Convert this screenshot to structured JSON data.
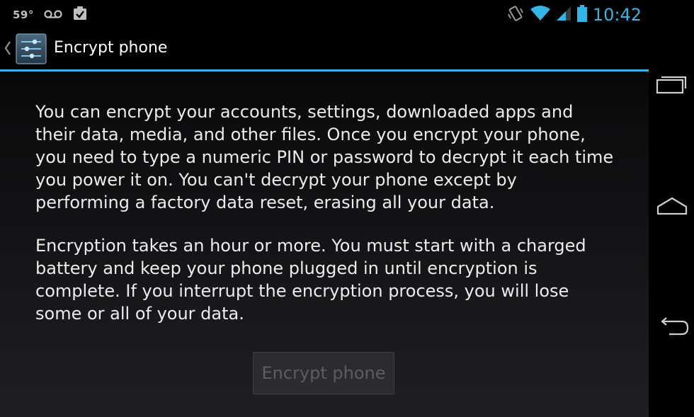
{
  "status_bar": {
    "temperature": "59°",
    "time": "10:42",
    "icons": [
      "voicemail-icon",
      "clipboard-check-icon",
      "vibrate-icon",
      "wifi-icon",
      "signal-icon",
      "battery-icon"
    ]
  },
  "action_bar": {
    "title": "Encrypt phone",
    "icon": "settings-sliders-icon"
  },
  "main": {
    "paragraphs": [
      "You can encrypt your accounts, settings, downloaded apps and their data, media, and other files. Once you encrypt your phone, you need to type a numeric PIN or password to decrypt it each time you power it on. You can't decrypt your phone except by performing a factory data reset, erasing all your data.",
      "Encryption takes an hour or more. You must start with a charged battery and keep your phone plugged in until encryption is complete. If you interrupt the encryption process, you will lose some or all of your data."
    ],
    "button_label": "Encrypt phone",
    "button_enabled": false
  },
  "nav_bar": {
    "buttons": [
      "recent-apps-icon",
      "home-icon",
      "back-icon"
    ]
  },
  "colors": {
    "accent": "#33b5e5",
    "text": "#ececec",
    "disabled_text": "#5b5d60"
  }
}
